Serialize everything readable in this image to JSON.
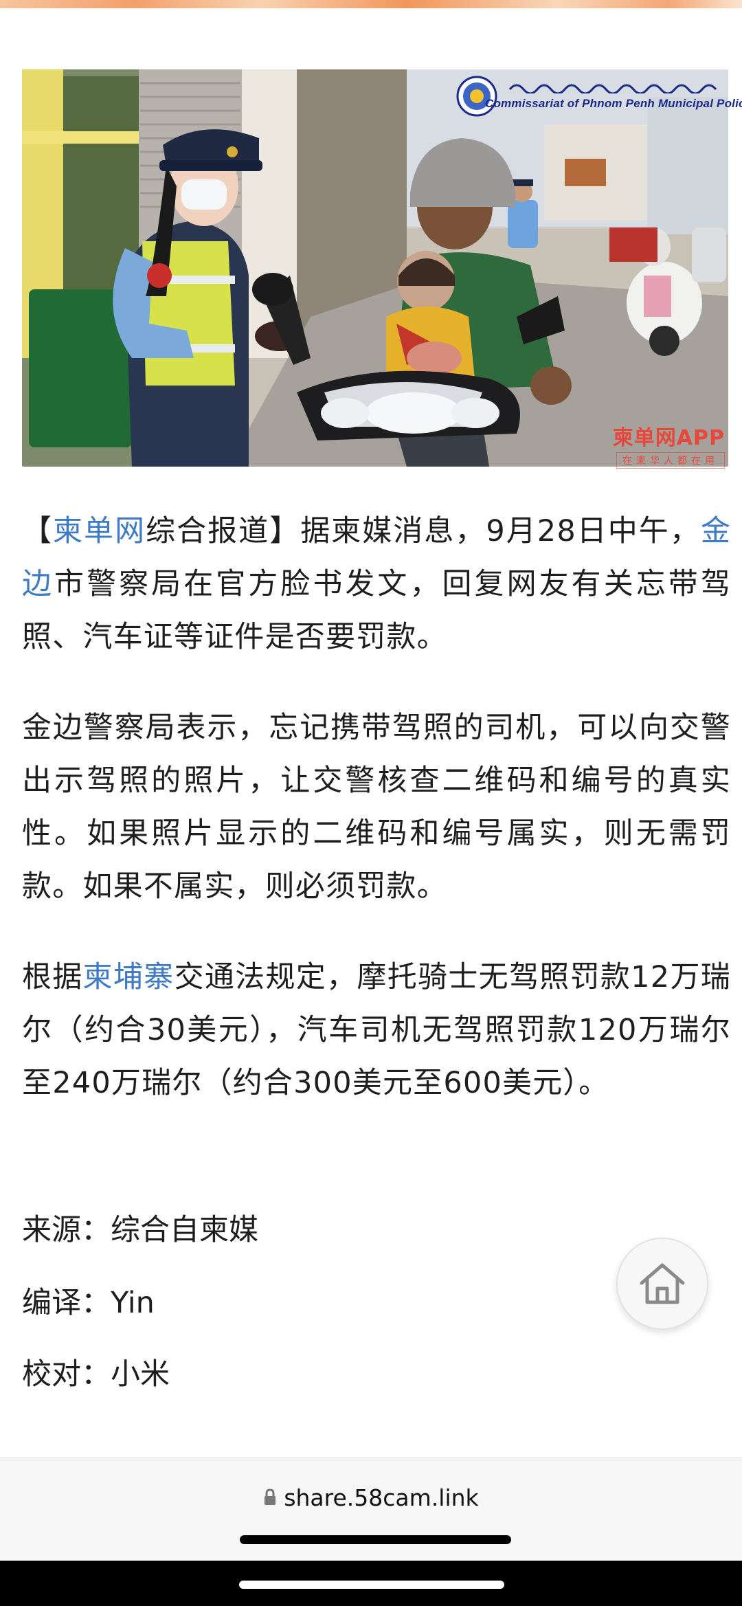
{
  "photo": {
    "caption_logo_en": "Commissariat of Phnom Penh Municipal Police",
    "watermark_brand": "柬单网APP",
    "watermark_tag": "在柬华人都在用"
  },
  "article": {
    "p1": {
      "open_bracket": "【",
      "source_link": "柬单网",
      "after_source": "综合报道】据柬媒消息，9月28日中午，",
      "city_link": "金边",
      "rest": "市警察局在官方脸书发文，回复网友有关忘带驾照、汽车证等证件是否要罚款。"
    },
    "p2": "金边警察局表示，忘记携带驾照的司机，可以向交警出示驾照的照片，让交警核查二维码和编号的真实性。如果照片显示的二维码和编号属实，则无需罚款。如果不属实，则必须罚款。",
    "p3": {
      "before_link": "根据",
      "country_link": "柬埔寨",
      "rest": "交通法规定，摩托骑士无驾照罚款12万瑞尔（约合30美元），汽车司机无驾照罚款120万瑞尔至240万瑞尔（约合300美元至600美元）。"
    },
    "meta": {
      "source": "来源：综合自柬媒",
      "translator": "编译：Yin",
      "proofreader": "校对：小米"
    }
  },
  "browser": {
    "url": "share.58cam.link",
    "lock_icon": "lock-icon",
    "home_icon": "home-icon"
  },
  "colors": {
    "link": "#3e7bc4",
    "text": "#1e1e1e",
    "watermark": "#e8473c"
  }
}
